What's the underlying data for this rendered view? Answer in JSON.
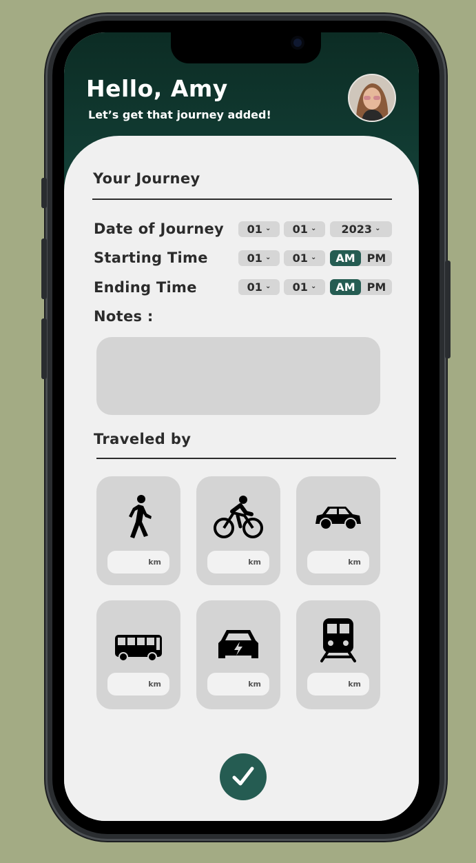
{
  "header": {
    "greeting": "Hello, Amy",
    "subtitle": "Let’s get that journey added!"
  },
  "journey": {
    "title": "Your Journey",
    "date": {
      "label": "Date of Journey",
      "day": "01",
      "month": "01",
      "year": "2023"
    },
    "start": {
      "label": "Starting Time",
      "hour": "01",
      "minute": "01",
      "am": "AM",
      "pm": "PM",
      "selected": "AM"
    },
    "end": {
      "label": "Ending Time",
      "hour": "01",
      "minute": "01",
      "am": "AM",
      "pm": "PM",
      "selected": "AM"
    },
    "notes_label": "Notes :"
  },
  "travel": {
    "title": "Traveled by",
    "unit": "km",
    "modes": [
      {
        "icon": "walking-icon"
      },
      {
        "icon": "bicycle-icon"
      },
      {
        "icon": "car-icon"
      },
      {
        "icon": "bus-icon"
      },
      {
        "icon": "electric-car-icon"
      },
      {
        "icon": "train-icon"
      }
    ]
  },
  "submit": {
    "icon": "checkmark-icon"
  },
  "colors": {
    "accent": "#255c52",
    "header_dark": "#0c2c24",
    "background": "#a3ab84",
    "field": "#d4d4d4"
  }
}
